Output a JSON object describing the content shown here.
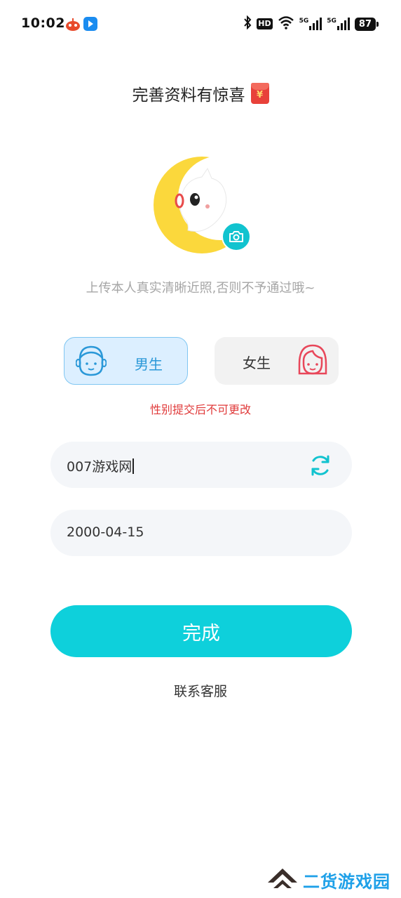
{
  "status_bar": {
    "time": "10:02",
    "hd_label": "HD",
    "signal1": "5G",
    "signal2": "5G",
    "battery": "87"
  },
  "header": {
    "title": "完善资料有惊喜",
    "title_icon": "red-packet-icon",
    "red_packet_symbol": "¥"
  },
  "avatar": {
    "icon": "moon-cat-avatar",
    "camera_icon": "camera-icon",
    "hint": "上传本人真实清晰近照,否则不予通过哦~"
  },
  "gender": {
    "male_label": "男生",
    "female_label": "女生",
    "selected": "male",
    "warning": "性别提交后不可更改"
  },
  "form": {
    "nickname_value": "007游戏网",
    "refresh_icon": "refresh-icon",
    "birthday_value": "2000-04-15"
  },
  "actions": {
    "submit_label": "完成",
    "service_label": "联系客服"
  },
  "watermark": {
    "text": "二货游戏园"
  },
  "colors": {
    "accent": "#0ed0db",
    "male_bg": "#dcefff",
    "male_text": "#2a98d8",
    "warning": "#e03a3a",
    "hint": "#a6a6a6"
  }
}
